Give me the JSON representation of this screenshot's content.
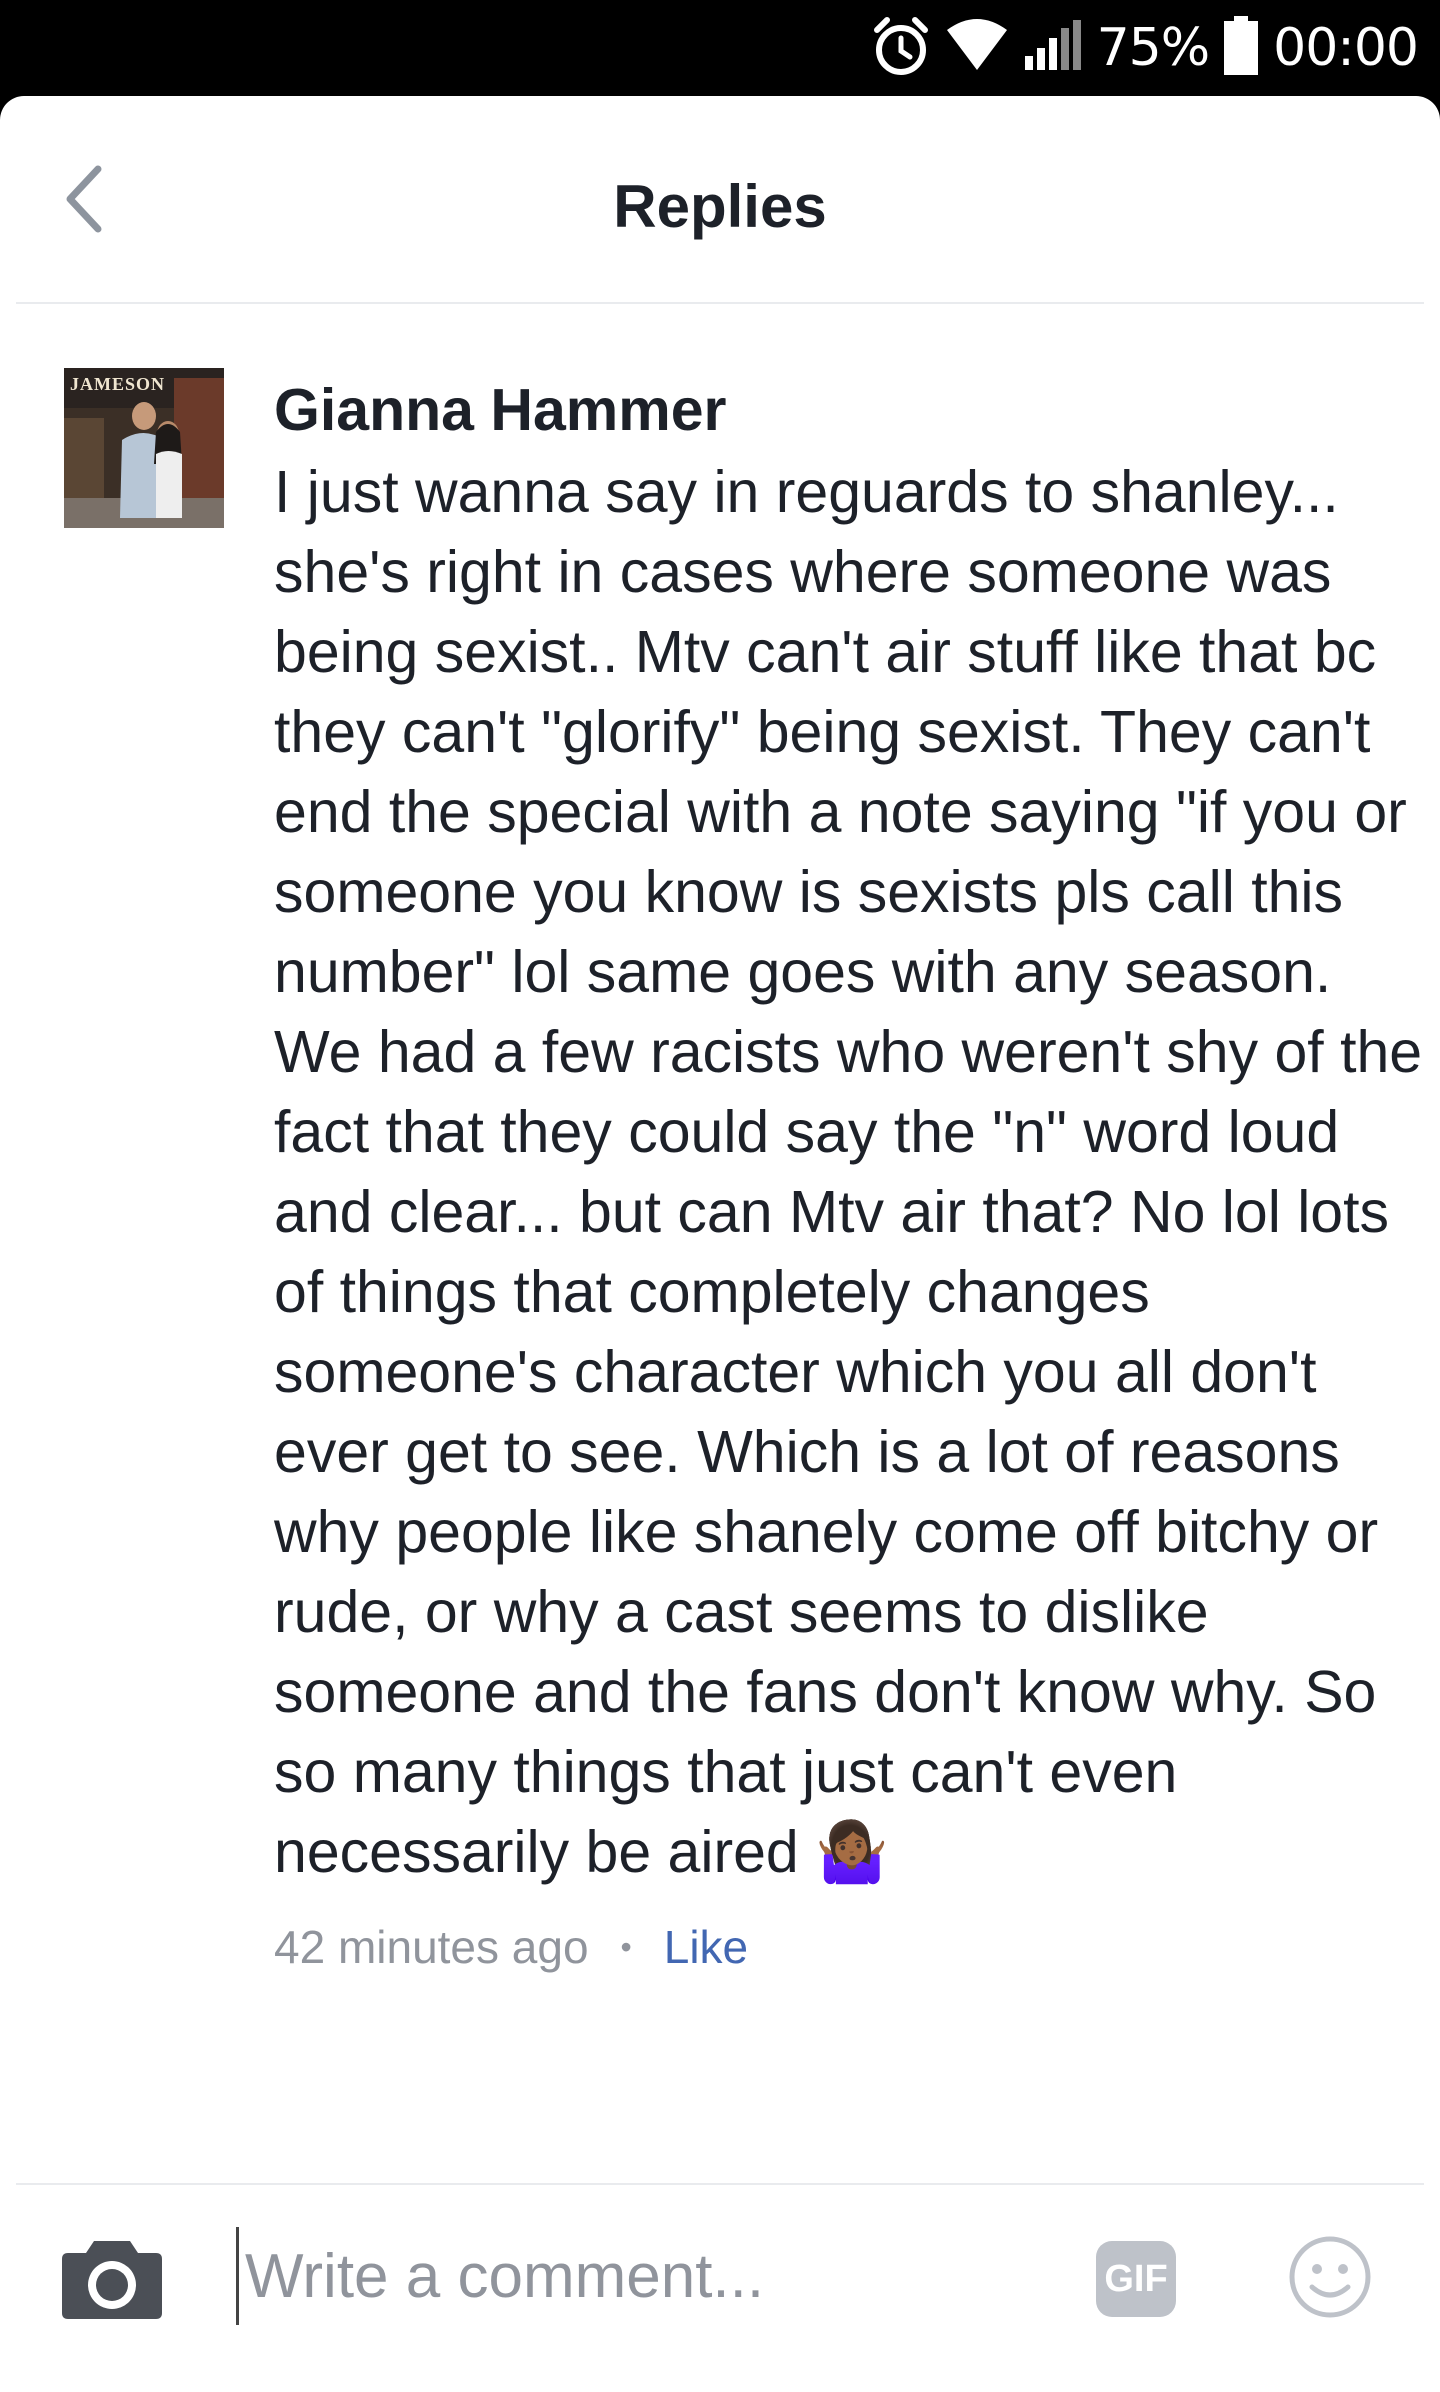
{
  "status_bar": {
    "battery": "75%",
    "time": "00:00",
    "icons": [
      "alarm-icon",
      "wifi-icon",
      "signal-icon",
      "battery-icon"
    ]
  },
  "header": {
    "title": "Replies",
    "back_icon": "chevron-left-icon"
  },
  "comment": {
    "author": "Gianna Hammer",
    "text": "I just wanna say in reguards to shanley... she's right in cases where someone was being sexist.. Mtv can't air stuff like that bc they can't \"glorify\" being sexist. They can't end the special with a note saying \"if you or someone you know is sexists pls call this number\" lol same goes with any season. We had a few racists who weren't shy of the fact that they could say the \"n\" word loud and clear... but can Mtv air that? No lol lots of things that completely changes someone's character which you all don't ever get to see. Which is a lot of reasons why people like shanely come off bitchy or rude, or why a cast seems to dislike someone and the fans don't know why. So so many things that just can't even necessarily be aired 🤷🏾‍♀️",
    "timestamp": "42 minutes ago",
    "separator": "•",
    "like_label": "Like",
    "avatar_text": "JAMESON"
  },
  "composer": {
    "placeholder": "Write a comment...",
    "gif_label": "GIF",
    "camera_icon": "camera-icon",
    "emoji_icon": "smiley-icon"
  },
  "colors": {
    "text": "#1d2129",
    "meta": "#90949c",
    "link": "#4267b2",
    "divider": "#e9ebee"
  }
}
